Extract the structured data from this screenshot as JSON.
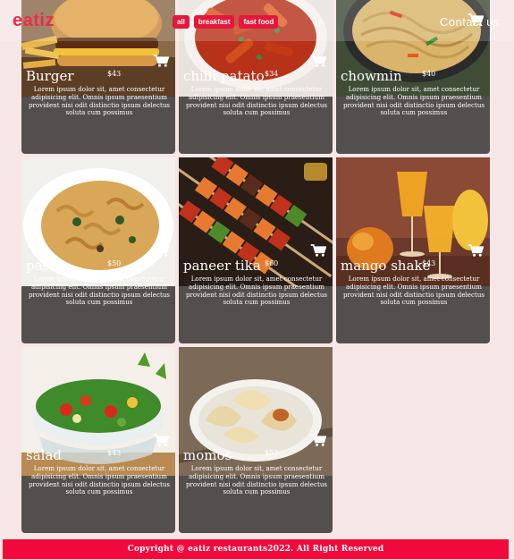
{
  "header": {
    "logo": "eatiz",
    "filters": [
      "all",
      "breakfast",
      "fast food"
    ],
    "contact": "Contact us"
  },
  "menu": {
    "items": [
      {
        "name": "Burger",
        "price": "$43",
        "image": "burger-photo"
      },
      {
        "name": "chilli patato",
        "price": "$34",
        "image": "chilli-potato-photo"
      },
      {
        "name": "chowmin",
        "price": "$40",
        "image": "chowmin-photo"
      },
      {
        "name": "pasta",
        "price": "$50",
        "image": "pasta-photo"
      },
      {
        "name": "paneer tika",
        "price": "$60",
        "image": "paneer-tika-photo"
      },
      {
        "name": "mango shake",
        "price": "$43",
        "image": "mango-shake-photo"
      },
      {
        "name": "salad",
        "price": "$43",
        "image": "salad-photo"
      },
      {
        "name": "momos",
        "price": "$53",
        "image": "momos-photo"
      }
    ],
    "description": "Lorem ipsum dolor sit, amet consectetur adipisicing elit. Omnis ipsum praesentium provident nisi odit distinctio ipsum delectus soluta cum possimus",
    "cart_icon": "shopping-cart-icon"
  },
  "footer": {
    "text": "Copyright @ eatiz restaurants2022. All Right Reserved"
  },
  "colors": {
    "accent": "#e5173a",
    "card_bg": "#534f4e",
    "page_bg": "#f7e6e6",
    "footer_bg": "#f1093b"
  }
}
